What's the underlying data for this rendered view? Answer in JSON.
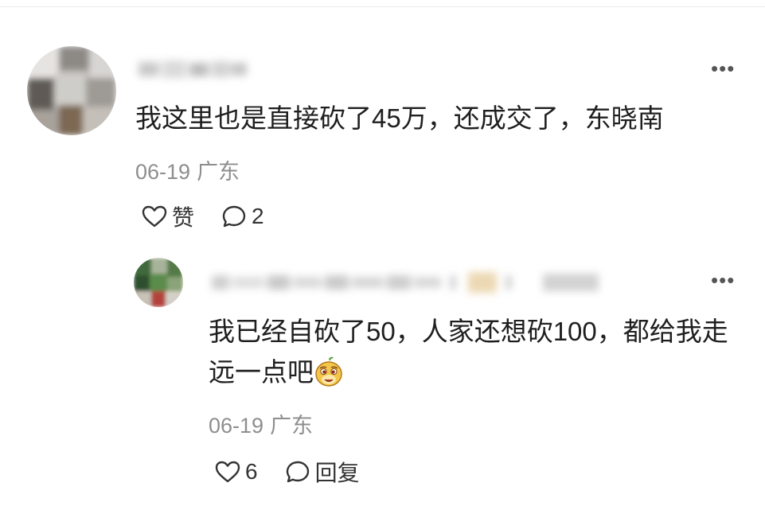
{
  "comment": {
    "text": "我这里也是直接砍了45万，还成交了，东晓南",
    "date": "06-19",
    "location": "广东",
    "like_label": "赞",
    "reply_count": "2",
    "more_icon": "ellipsis-icon"
  },
  "reply": {
    "text": "我已经自砍了50，人家还想砍100，都给我走远一点吧",
    "emoji": "sly-face-emoji",
    "date": "06-19",
    "location": "广东",
    "like_count": "6",
    "reply_label": "回复",
    "more_icon": "ellipsis-icon"
  }
}
